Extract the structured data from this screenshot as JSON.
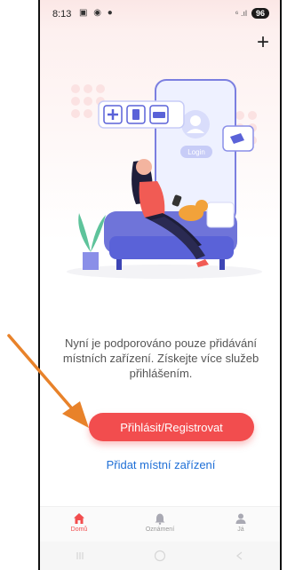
{
  "status_bar": {
    "time": "8:13",
    "notification_icons": [
      "qr-icon",
      "app-icon",
      "location-icon"
    ],
    "signal_text": "⁶ .ıl",
    "battery": "96"
  },
  "header": {
    "add_label": "+"
  },
  "illustration": {
    "login_label": "Login"
  },
  "main": {
    "message": "Nyní je podporováno pouze přidávání místních zařízení. Získejte více služeb přihlášením.",
    "login_button": "Přihlásit/Registrovat",
    "add_local_device": "Přidat místní zařízení"
  },
  "tabs": [
    {
      "label": "Domů",
      "icon": "home-icon",
      "active": true
    },
    {
      "label": "Oznámení",
      "icon": "bell-icon",
      "active": false
    },
    {
      "label": "Já",
      "icon": "person-icon",
      "active": false
    }
  ],
  "colors": {
    "accent": "#f24d4e",
    "link": "#1f6fd6",
    "annotation_arrow": "#e8822a"
  }
}
